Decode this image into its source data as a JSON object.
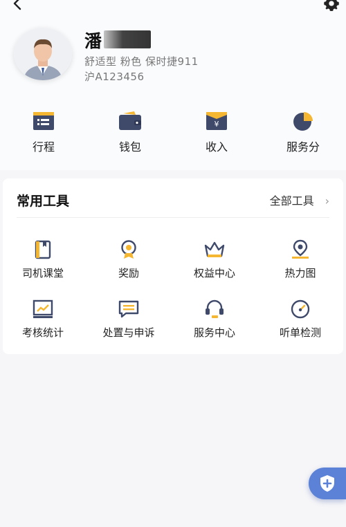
{
  "profile": {
    "name": "潘",
    "car": "舒适型 粉色 保时捷911",
    "plate": "沪A123456"
  },
  "quick_actions": [
    {
      "label": "行程",
      "icon": "trip-icon"
    },
    {
      "label": "钱包",
      "icon": "wallet-icon"
    },
    {
      "label": "收入",
      "icon": "income-icon"
    },
    {
      "label": "服务分",
      "icon": "service-score-icon"
    }
  ],
  "tools": {
    "title": "常用工具",
    "all_label": "全部工具",
    "items": [
      {
        "label": "司机课堂",
        "icon": "driver-class-icon"
      },
      {
        "label": "奖励",
        "icon": "reward-icon"
      },
      {
        "label": "权益中心",
        "icon": "benefits-icon"
      },
      {
        "label": "热力图",
        "icon": "heatmap-icon"
      },
      {
        "label": "考核统计",
        "icon": "stats-icon"
      },
      {
        "label": "处置与申诉",
        "icon": "appeal-icon"
      },
      {
        "label": "服务中心",
        "icon": "service-center-icon"
      },
      {
        "label": "听单检测",
        "icon": "order-check-icon"
      }
    ]
  },
  "colors": {
    "icon_dark": "#3f4a6b",
    "icon_accent": "#f5b731",
    "fab_blue": "#5b82d6"
  }
}
